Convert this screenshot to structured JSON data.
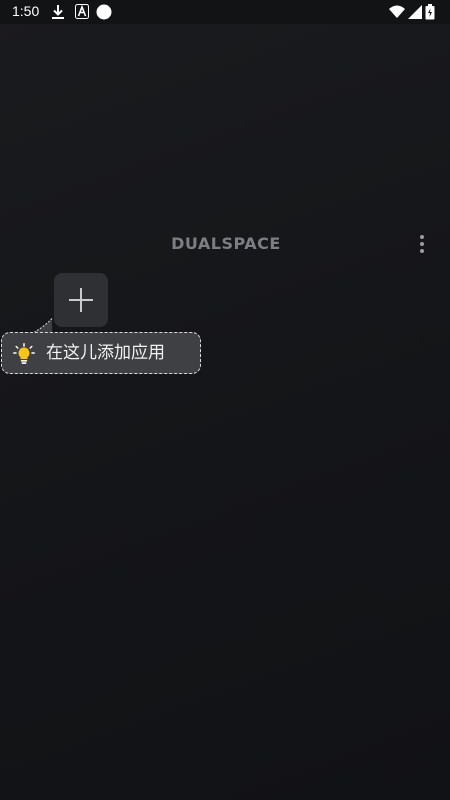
{
  "status_bar": {
    "time": "1:50",
    "left_icons": [
      "download-icon",
      "app-a-icon",
      "circle-icon"
    ],
    "right_icons": [
      "wifi-icon",
      "signal-icon",
      "battery-icon"
    ]
  },
  "header": {
    "logo_text": "DUALSPACE",
    "menu_icon": "more-vert-icon"
  },
  "main": {
    "add_button_icon": "plus-icon",
    "tooltip": {
      "icon": "lightbulb-icon",
      "text": "在这儿添加应用"
    }
  },
  "colors": {
    "background": "#141518",
    "tile": "#2f3034",
    "tooltip_bg": "#3f4043",
    "bulb": "#f5c518",
    "logo": "#7c7e83"
  }
}
